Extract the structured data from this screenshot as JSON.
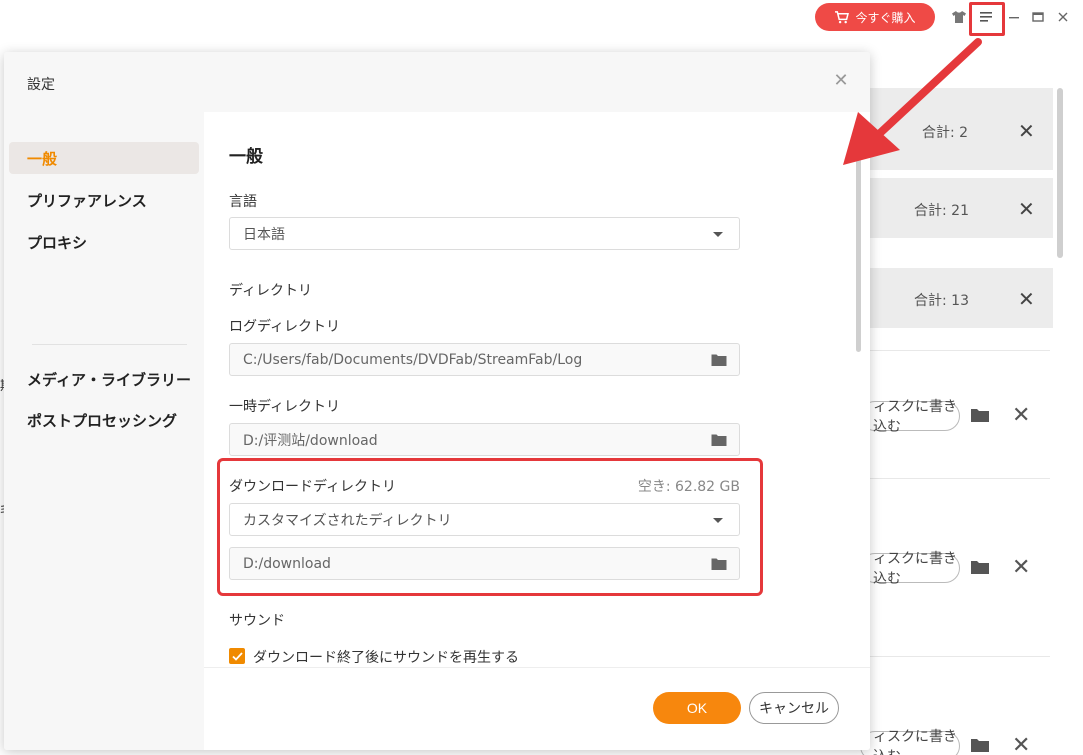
{
  "app": {
    "buy_label": "今すぐ購入",
    "accent": "#ef4a46",
    "icons": [
      "cart-icon",
      "shirt-icon",
      "menu-icon",
      "minimize-icon",
      "maximize-icon",
      "close-icon"
    ]
  },
  "background": {
    "cards": [
      {
        "total": "合計: 2"
      },
      {
        "total": "合計: 21"
      },
      {
        "total": "合計: 13"
      }
    ],
    "rows": [
      {
        "burn_label": "ィスクに書き込む"
      },
      {
        "burn_label": "ィスクに書き込む"
      },
      {
        "burn_label": "ィスクに書き込む"
      }
    ],
    "left_chars": [
      "期",
      "毛"
    ]
  },
  "dialog": {
    "title": "設定",
    "sidebar": {
      "items": [
        {
          "label": "一般",
          "active": true
        },
        {
          "label": "プリファアレンス"
        },
        {
          "label": "プロキシ"
        },
        {
          "label": "メディア・ライブラリー"
        },
        {
          "label": "ポストプロセッシング"
        }
      ]
    },
    "content": {
      "section_title": "一般",
      "language": {
        "label": "言語",
        "value": "日本語"
      },
      "directory": {
        "label": "ディレクトリ",
        "log": {
          "label": "ログディレクトリ",
          "value": "C:/Users/fab/Documents/DVDFab/StreamFab/Log"
        },
        "temp": {
          "label": "一時ディレクトリ",
          "value": "D:/评测站/download"
        },
        "download": {
          "label": "ダウンロードディレクトリ",
          "free_space": "空き: 62.82 GB",
          "mode": "カスタマイズされたディレクトリ",
          "path": "D:/download"
        }
      },
      "sound": {
        "label": "サウンド",
        "play_on_finish": "ダウンロード終了後にサウンドを再生する",
        "checked": true
      }
    },
    "footer": {
      "ok_label": "OK",
      "cancel_label": "キャンセル"
    },
    "colors": {
      "accent_orange": "#f08a00",
      "highlight_red": "#e5383b"
    }
  }
}
